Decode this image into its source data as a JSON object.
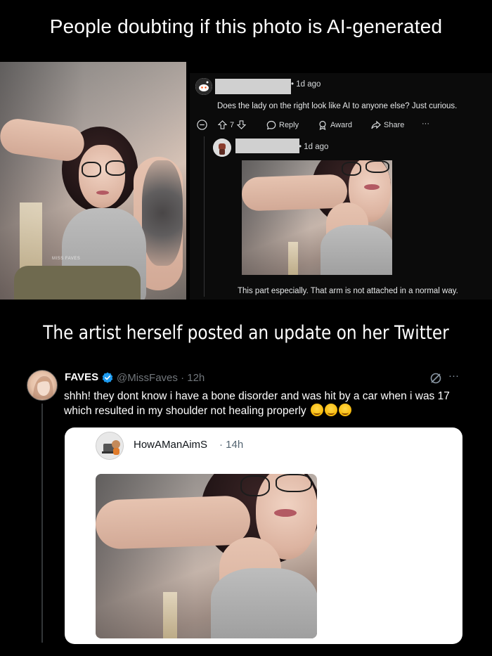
{
  "headings": {
    "top": "People doubting if this photo is AI-generated",
    "middle": "The artist herself posted an update on her Twitter"
  },
  "original_photo": {
    "watermark": "MISS FAVES"
  },
  "reddit": {
    "comment1": {
      "time": "1d ago",
      "text": "Does the lady on the right look like AI to anyone else? Just curious.",
      "vote_count": "7",
      "actions": {
        "reply": "Reply",
        "award": "Award",
        "share": "Share",
        "more": "···"
      }
    },
    "comment2": {
      "time": "1d ago",
      "text": "This part especially. That arm is not attached in a normal way."
    }
  },
  "twitter": {
    "tweet": {
      "name": "FAVES",
      "handle": "@MissFaves · 12h",
      "text": "shhh!  they dont know i have a bone disorder and was hit by a car when i was 17 which resulted in my shoulder not healing properly",
      "more": "···"
    },
    "quote": {
      "name": "HowAManAimS",
      "time": "· 14h"
    }
  },
  "colors": {
    "background": "#000000",
    "reddit_panel": "#0b0b0b",
    "twitter_verified": "#1d9bf0",
    "twitter_secondary": "#71767b"
  },
  "icons": [
    "reddit-avatar-icon",
    "collapse-icon",
    "upvote-icon",
    "downvote-icon",
    "reply-icon",
    "award-icon",
    "share-icon",
    "verified-badge-icon",
    "grok-icon",
    "emoji-icon"
  ]
}
